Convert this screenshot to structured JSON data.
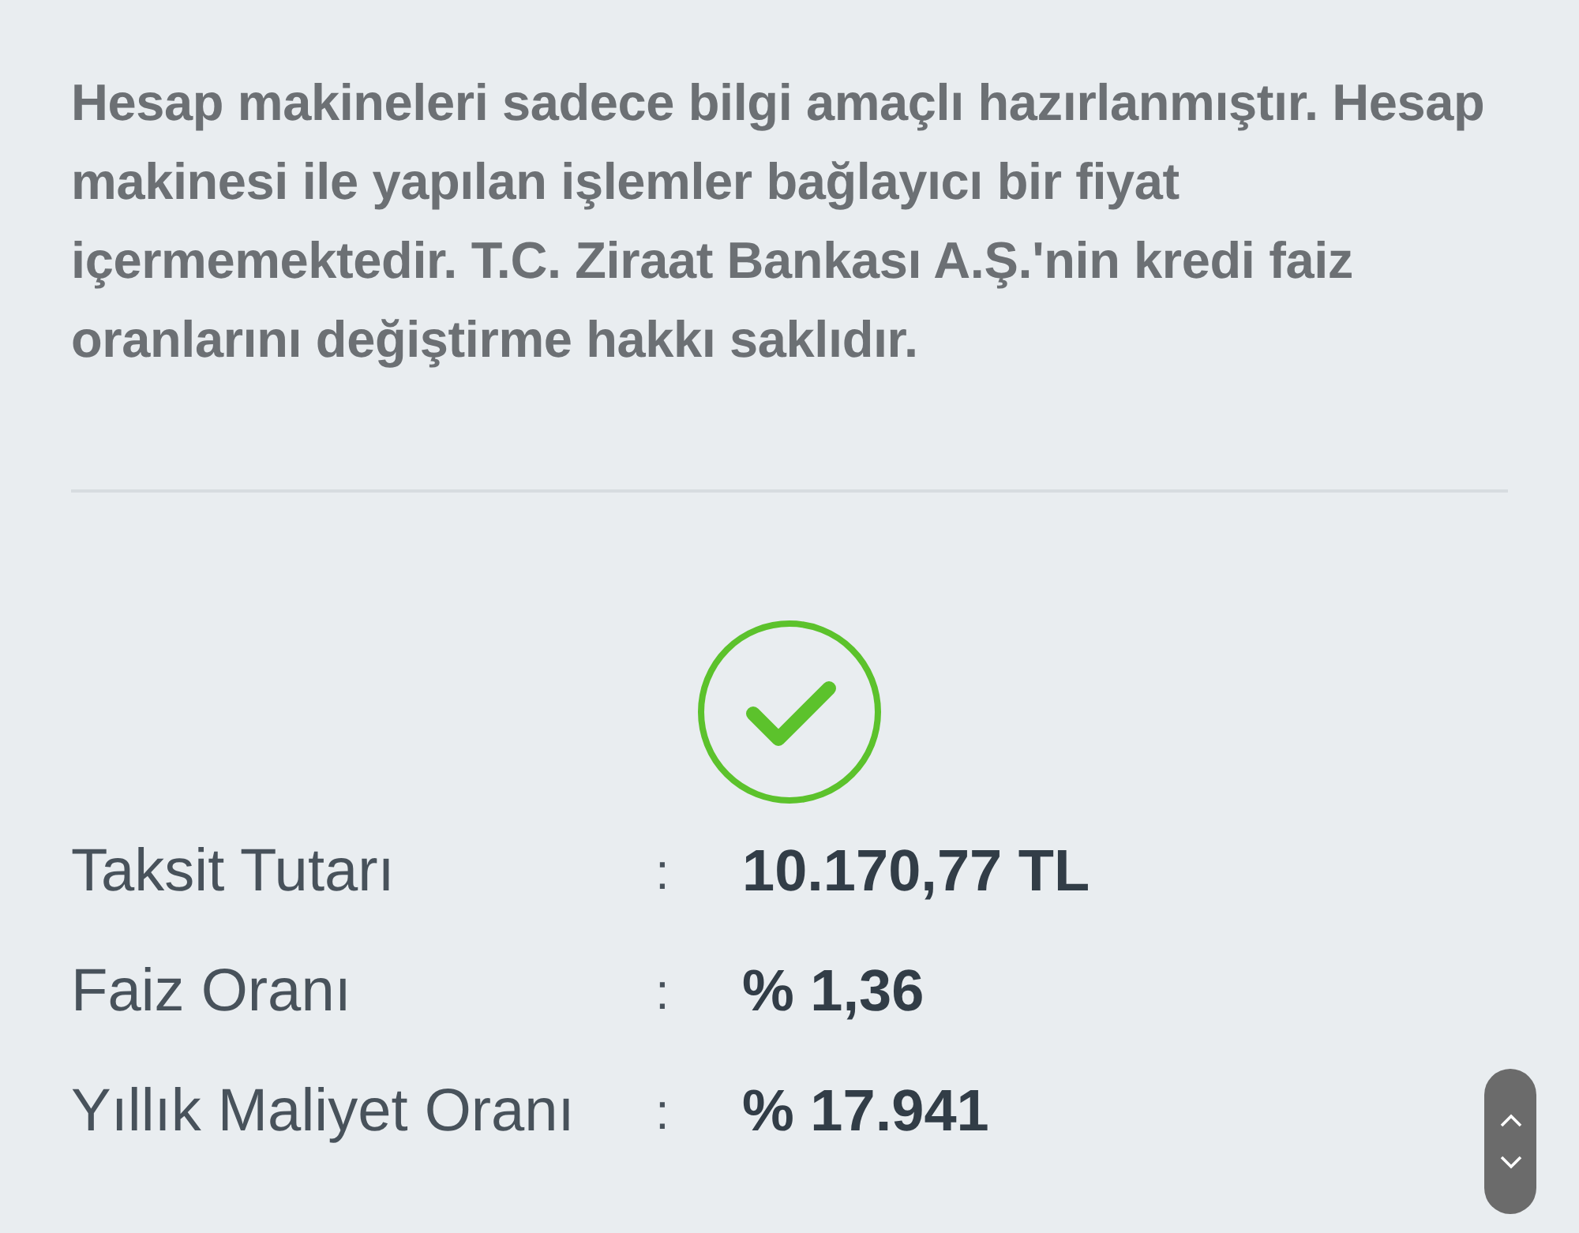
{
  "disclaimer": "Hesap makineleri sadece bilgi amaçlı hazırlanmıştır. Hesap makinesi ile yapılan işlemler bağlayıcı bir fiyat içermemektedir. T.C. Ziraat Bankası A.Ş.'nin kredi faiz oranlarını değiştirme hakkı saklıdır.",
  "result": {
    "success": true,
    "rows": [
      {
        "label": "Taksit Tutarı",
        "separator": ":",
        "value": "10.170,77 TL"
      },
      {
        "label": "Faiz Oranı",
        "separator": ":",
        "value": "% 1,36"
      },
      {
        "label": "Yıllık Maliyet Oranı",
        "separator": ":",
        "value": "% 17.941"
      }
    ]
  }
}
